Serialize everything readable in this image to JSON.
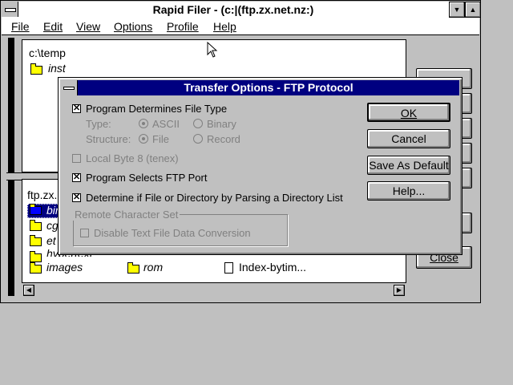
{
  "window": {
    "title": "Rapid Filer - (c:|(ftp.zx.net.nz:)",
    "minimize_glyph": "▼",
    "maximize_glyph": "▲"
  },
  "menu": [
    "File",
    "Edit",
    "View",
    "Options",
    "Profile",
    "Help"
  ],
  "local_pane": {
    "path": "c:\\temp",
    "items": [
      {
        "name": "inst",
        "type": "folder"
      }
    ]
  },
  "remote_pane": {
    "path": "ftp.zx.",
    "items": [
      {
        "name": "bin",
        "type": "folder",
        "selected": true
      },
      {
        "name": "cg",
        "type": "folder"
      },
      {
        "name": "et",
        "type": "folder"
      },
      {
        "name": "hypertext",
        "type": "folder"
      },
      {
        "name": "images",
        "type": "folder"
      },
      {
        "name": "rom",
        "type": "folder"
      },
      {
        "name": "Index-bytim...",
        "type": "file"
      }
    ]
  },
  "side_buttons": {
    "close": "Close"
  },
  "dialog": {
    "title": "Transfer Options - FTP Protocol",
    "program_determines_file_type": "Program Determines File Type",
    "type_label": "Type:",
    "ascii": "ASCII",
    "binary": "Binary",
    "structure_label": "Structure:",
    "file": "File",
    "record": "Record",
    "local_byte": "Local Byte 8 (tenex)",
    "program_selects_port": "Program Selects FTP Port",
    "determine_parsing": "Determine if File or Directory by Parsing a Directory List",
    "group_label": "Remote Character Set",
    "disable_conversion": "Disable Text File Data Conversion",
    "checked": {
      "file_type": true,
      "local_byte": false,
      "ftp_port": true,
      "parsing": true,
      "disable_conversion": false
    },
    "buttons": {
      "ok": "OK",
      "cancel": "Cancel",
      "save_default": "Save As Default",
      "help": "Help..."
    }
  }
}
